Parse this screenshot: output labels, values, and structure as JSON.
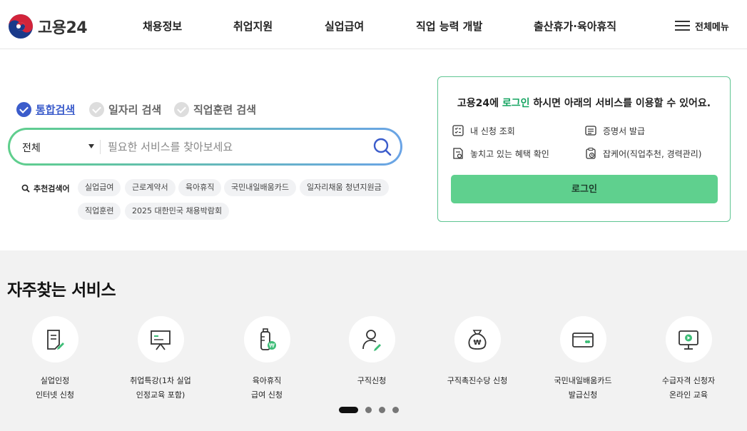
{
  "header": {
    "logo_text": "고용24",
    "nav": [
      "채용정보",
      "취업지원",
      "실업급여",
      "직업 능력 개발",
      "출산휴가·육아휴직"
    ],
    "all_menu": "전체메뉴"
  },
  "search": {
    "tabs": [
      {
        "label": "통합검색",
        "active": true
      },
      {
        "label": "일자리 검색",
        "active": false
      },
      {
        "label": "직업훈련 검색",
        "active": false
      }
    ],
    "category": "전체",
    "placeholder": "필요한 서비스를 찾아보세요",
    "recommend_label": "추천검색어",
    "keywords": [
      "실업급여",
      "근로계약서",
      "육아휴직",
      "국민내일배움카드",
      "일자리채움 청년지원금",
      "직업훈련",
      "2025 대한민국 채용박람회"
    ]
  },
  "login_panel": {
    "msg_prefix": "고용24에 ",
    "msg_highlight": "로그인",
    "msg_suffix": " 하시면 아래의 서비스를 이용할 수 있어요.",
    "services": [
      "내 신청 조회",
      "증명서 발급",
      "놓치고 있는 혜택 확인",
      "잡케어(직업추천, 경력관리)"
    ],
    "button": "로그인"
  },
  "frequent": {
    "title": "자주찾는 서비스",
    "items": [
      {
        "line1": "실업인정",
        "line2": "인터넷 신청",
        "icon": "document-edit-icon"
      },
      {
        "line1": "취업특강(1차 실업",
        "line2": "인정교육 포함)",
        "icon": "presentation-board-icon"
      },
      {
        "line1": "육아휴직",
        "line2": "급여 신청",
        "icon": "baby-bottle-icon"
      },
      {
        "line1": "구직신청",
        "line2": "",
        "icon": "person-edit-icon"
      },
      {
        "line1": "구직촉진수당 신청",
        "line2": "",
        "icon": "money-bag-icon"
      },
      {
        "line1": "국민내일배움카드",
        "line2": "발급신청",
        "icon": "card-icon"
      },
      {
        "line1": "수급자격 신청자",
        "line2": "온라인 교육",
        "icon": "monitor-play-icon"
      }
    ],
    "pages": 4,
    "active_page": 1
  },
  "colors": {
    "accent_blue": "#3b5ccb",
    "accent_green": "#5fd08e",
    "highlight_green": "#15a461"
  }
}
